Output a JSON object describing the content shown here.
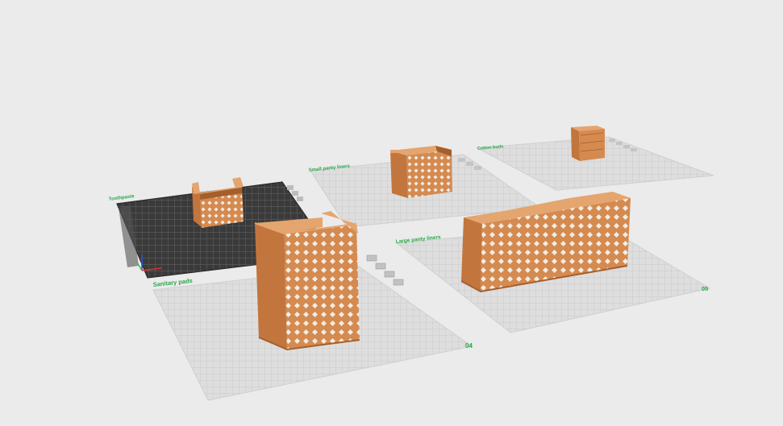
{
  "app": {
    "view": "3d-prepare-view"
  },
  "colors": {
    "background": "#ebebeb",
    "plate_inactive": "#dedede",
    "plate_grid": "#c9c9c9",
    "plate_active": "#3a3a3a",
    "plate_active_grid": "#666666",
    "filament": "#d58a4f",
    "filament_dark": "#a55f2c",
    "filament_light": "#e5a56f",
    "label_green": "#27a84a",
    "axis_x": "#e0312b",
    "axis_y": "#2dbe4c",
    "axis_z": "#2f52e0"
  },
  "plates": [
    {
      "label": "Toothpaste",
      "number": "",
      "active": true
    },
    {
      "label": "Small panty liners",
      "number": "",
      "active": false
    },
    {
      "label": "Cotton buds",
      "number": "",
      "active": false
    },
    {
      "label": "Sanitary pads",
      "number": "04",
      "active": false
    },
    {
      "label": "Large panty liners",
      "number": "05",
      "active": false
    }
  ],
  "icons": [
    "plate-settings-icon",
    "arrange-icon",
    "orient-icon",
    "lock-icon",
    "edit-icon"
  ]
}
